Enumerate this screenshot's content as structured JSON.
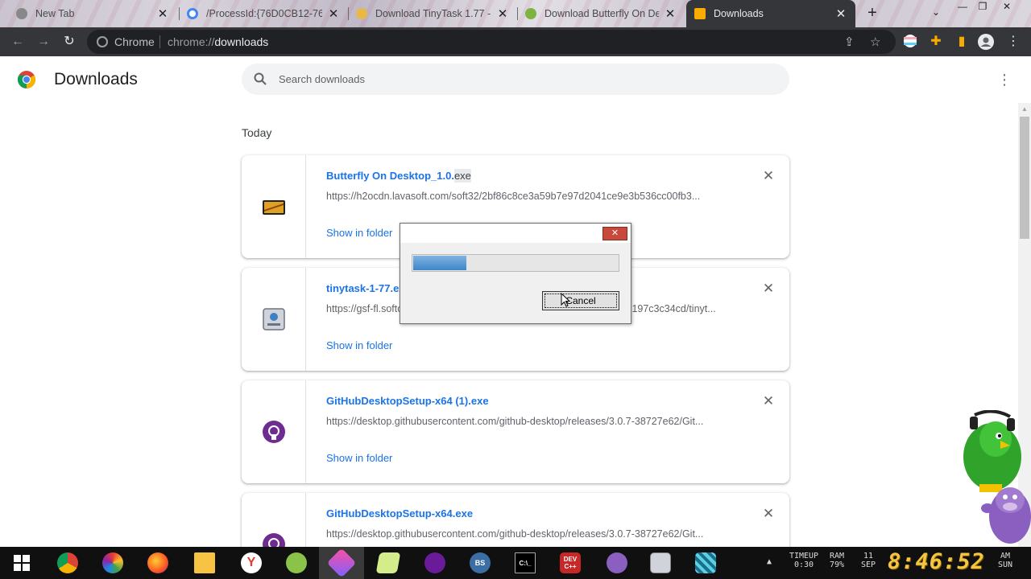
{
  "browser": {
    "tabs": [
      {
        "title": "New Tab",
        "active": false
      },
      {
        "title": "/ProcessId:{76D0CB12-760",
        "active": false
      },
      {
        "title": "Download TinyTask 1.77 -",
        "active": false
      },
      {
        "title": "Download Butterfly On De",
        "active": false
      },
      {
        "title": "Downloads",
        "active": true
      }
    ],
    "new_tab_symbol": "+",
    "close_symbol": "✕",
    "address": {
      "site_label": "Chrome",
      "url_prefix": "chrome://",
      "url_path": "downloads"
    }
  },
  "page": {
    "title": "Downloads",
    "search_placeholder": "Search downloads",
    "date_header": "Today"
  },
  "downloads": [
    {
      "name": "Butterfly On Desktop_1.0.",
      "ext": "exe",
      "url": "https://h2ocdn.lavasoft.com/soft32/2bf86c8ce3a59b7e97d2041ce9e3b536cc00fb3...",
      "action": "Show in folder",
      "icon": "butterfly-app-icon"
    },
    {
      "name": "tinytask-1-77.exe",
      "ext": "",
      "url": "https://gsf-fl.softonic.com/7f0/0d3/29ca01c7bb0e5ae3cdeab15e1a43197c3c34cd/tinyt...",
      "action": "Show in folder",
      "icon": "tinytask-app-icon"
    },
    {
      "name": "GitHubDesktopSetup-x64 (1).exe",
      "ext": "",
      "url": "https://desktop.githubusercontent.com/github-desktop/releases/3.0.7-38727e62/Git...",
      "action": "Show in folder",
      "icon": "github-icon"
    },
    {
      "name": "GitHubDesktopSetup-x64.exe",
      "ext": "",
      "url": "https://desktop.githubusercontent.com/github-desktop/releases/3.0.7-38727e62/Git...",
      "action": "Show in folder",
      "icon": "github-icon"
    }
  ],
  "dialog": {
    "cancel_label": "Cancel",
    "close_symbol": "✕",
    "progress_fraction": 0.26
  },
  "taskbar": {
    "apps": [
      "windows-start",
      "chrome",
      "picasa",
      "firefox",
      "file-explorer",
      "yandex",
      "growtopia",
      "app-active",
      "notepad",
      "yahoo-messenger",
      "bonzi-buddy-alt",
      "command-prompt",
      "dev-cpp",
      "bonzi-buddy",
      "tinytask",
      "pixel-app"
    ],
    "timeup_label": "TIMEUP",
    "timeup_value": "0:30",
    "ram_label": "RAM",
    "ram_value": "79%",
    "date_day": "11",
    "date_month": "SEP",
    "clock": "8:46:52",
    "ampm": "AM",
    "weekday": "SUN",
    "dev_label": "DEV",
    "devcpp_label": "C++"
  },
  "colors": {
    "link_blue": "#1a73e8",
    "toolbar_dark": "#35363a",
    "dialog_close_red": "#c7493b",
    "progress_blue": "#3e86c9",
    "clock_yellow": "#f5c542"
  }
}
